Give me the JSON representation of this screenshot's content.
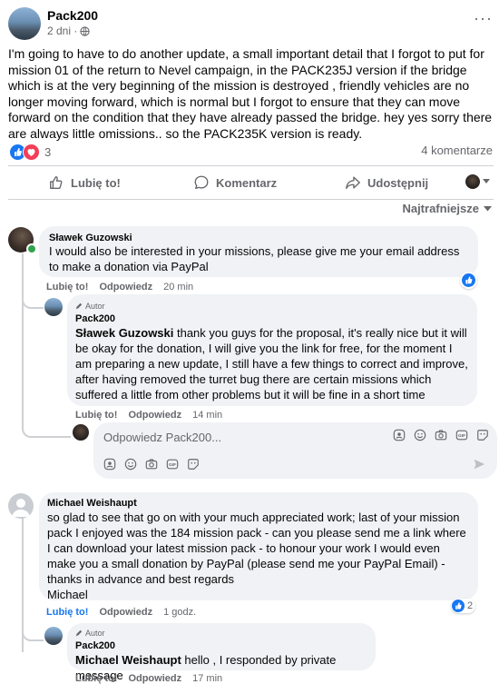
{
  "post": {
    "author": "Pack200",
    "time": "2 dni ·",
    "more": "···",
    "body": "I'm going to have to do another update, a small important detail that I forgot to put for mission 01 of the return to Nevel campaign, in the PACK235J version if the bridge which is at the very beginning of the mission is destroyed , friendly vehicles are no longer moving forward, which is normal but I forgot to ensure that they can move forward on the condition that they have already passed the bridge. hey yes sorry there are always little omissions.. so the PACK235K version is ready.",
    "reaction_count": "3",
    "comments_count": "4 komentarze"
  },
  "actions": {
    "like": "Lubię to!",
    "comment": "Komentarz",
    "share": "Udostępnij"
  },
  "sort_label": "Najtrafniejsze",
  "comments": [
    {
      "author": "Sławek Guzowski",
      "text": "I would also be interested in your missions, please give me your email address to make a donation via PayPal",
      "like": "Lubię to!",
      "reply": "Odpowiedz",
      "time": "20 min"
    },
    {
      "badge": "Autor",
      "author": "Pack200",
      "mention": "Sławek Guzowski",
      "text": " thank you guys for the proposal, it's really nice but it will be okay for the donation, I will give you the link for free, for the moment I am preparing a new update, I still have a few things to correct and improve, after having removed the turret bug there are certain missions which suffered a little from other problems but it will be fine in a short time",
      "like": "Lubię to!",
      "reply": "Odpowiedz",
      "time": "14 min"
    },
    {
      "author": "Michael Weishaupt",
      "text": "so glad to see that go on with your much appreciated work; last of your mission pack I enjoyed was the 184 mission pack - can you please send me a link where I can download your latest mission pack - to honour your work I would even make you a small donation by PayPal (please send me your PayPal Email) - thanks in advance and best regards\nMichael",
      "like": "Lubię to!",
      "reply": "Odpowiedz",
      "time": "1 godz.",
      "reaction_count": "2"
    },
    {
      "badge": "Autor",
      "author": "Pack200",
      "mention": "Michael Weishaupt",
      "text": " hello , I responded by private message",
      "like": "Lubię to!",
      "reply": "Odpowiedz",
      "time": "17 min"
    }
  ],
  "reply_box": {
    "placeholder": "Odpowiedz Pack200..."
  },
  "colors": {
    "accent": "#1877f2",
    "love": "#f33e58",
    "bubble": "#f0f2f5",
    "muted": "#65676b"
  }
}
